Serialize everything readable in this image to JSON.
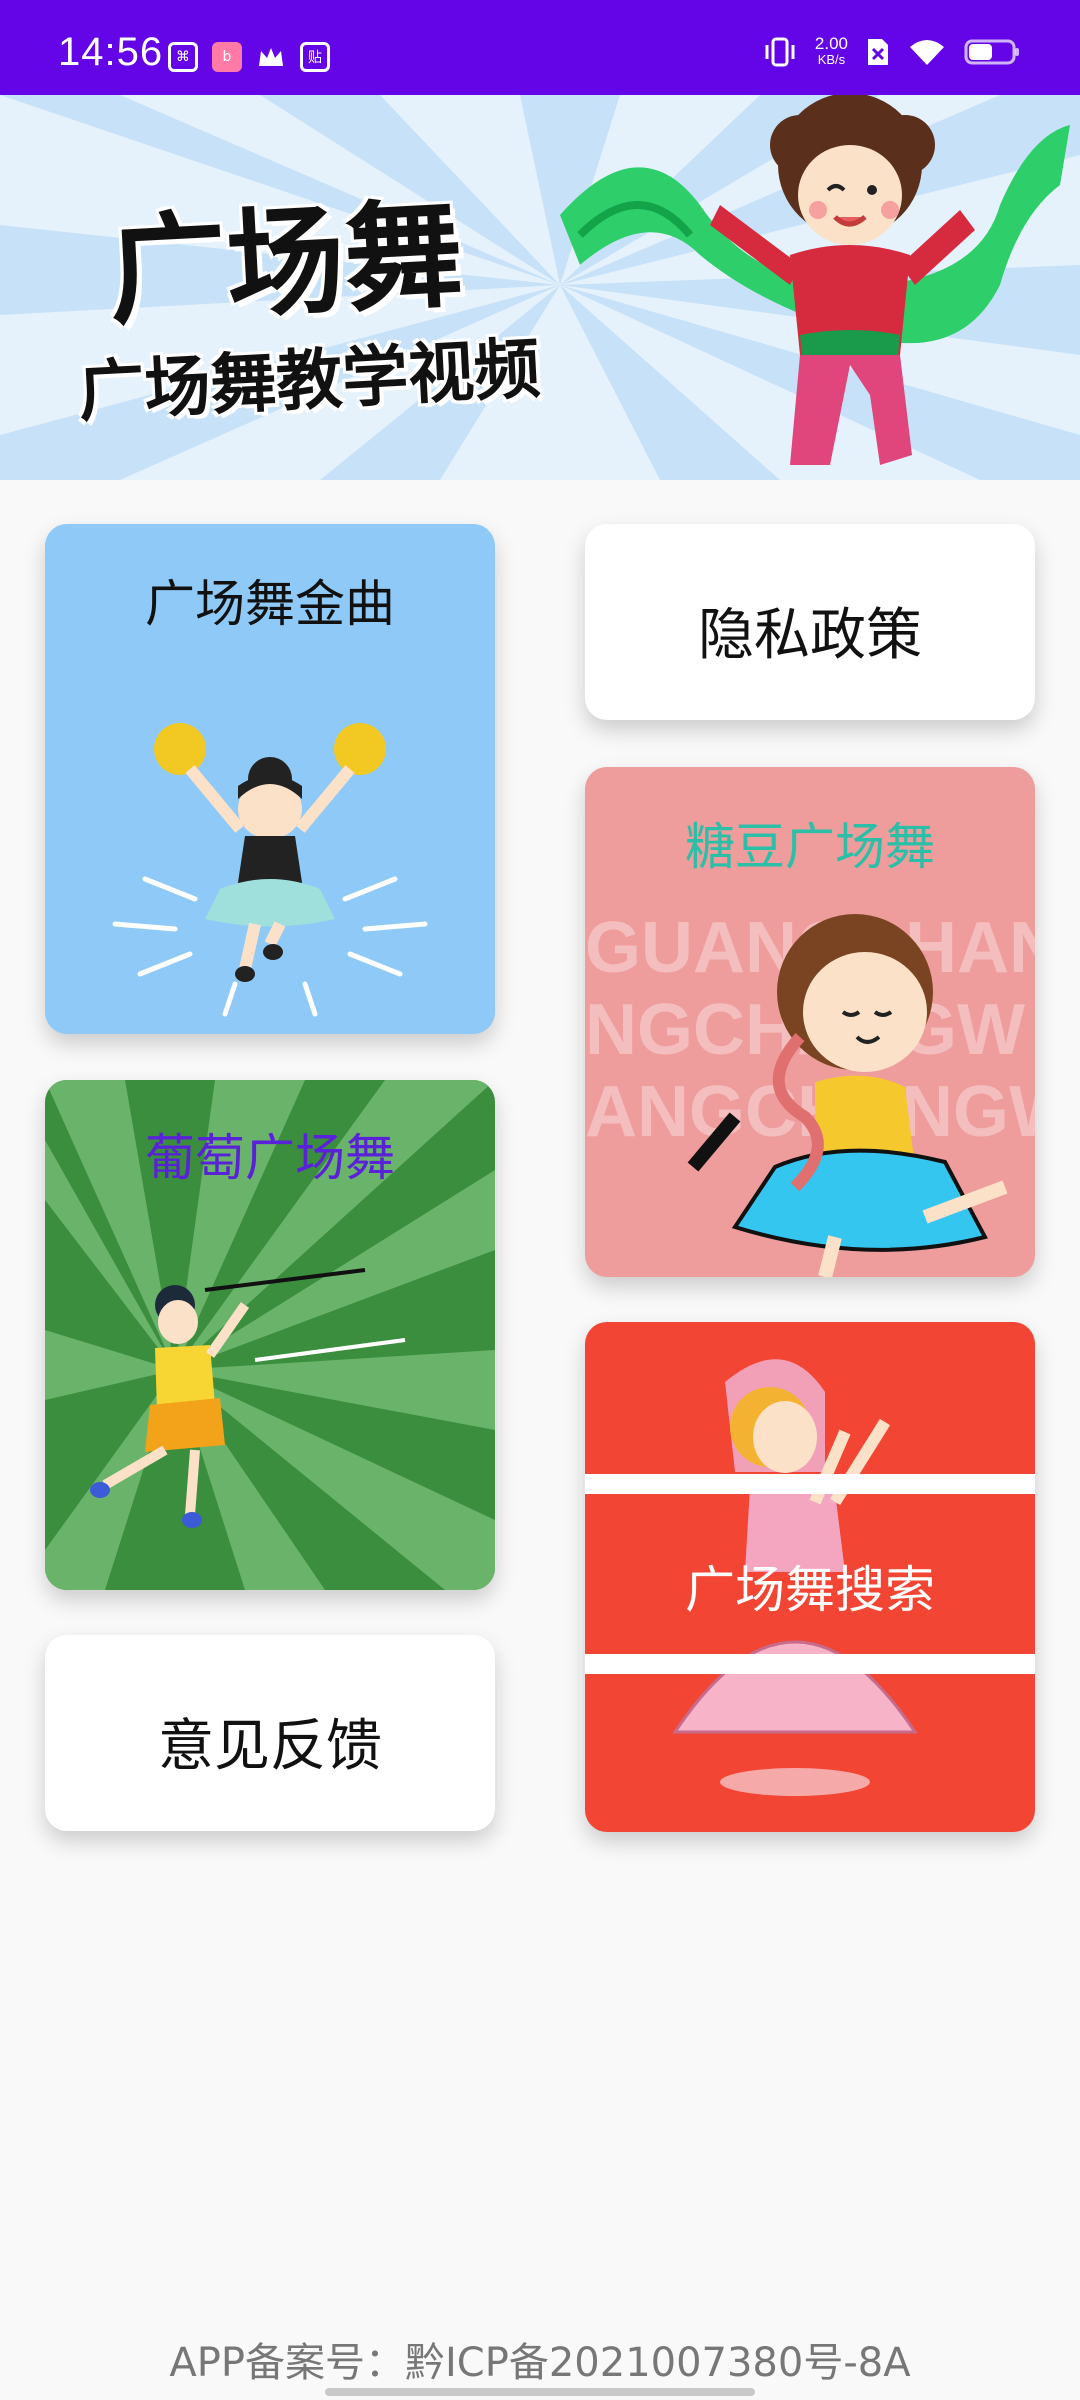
{
  "status_bar": {
    "time": "14:56",
    "left_icons": [
      "gallery-app-icon",
      "bilibili-icon",
      "crown-icon",
      "tieba-icon"
    ],
    "left_icon_glyphs": [
      "⌘",
      "b",
      "",
      "贴"
    ],
    "net_speed_value": "2.00",
    "net_speed_unit": "KB/s",
    "right_icons": [
      "vibrate-icon",
      "sim-x-icon",
      "wifi-icon",
      "battery-icon"
    ],
    "battery_level": 0.55,
    "background_color": "#6305e6"
  },
  "banner": {
    "title": "广场舞",
    "subtitle": "广场舞教学视频"
  },
  "cards": {
    "jinqu": {
      "label": "广场舞金曲",
      "bg": "#8ec9f7"
    },
    "privacy": {
      "label": "隐私政策",
      "bg": "#ffffff"
    },
    "tangdou": {
      "label": "糖豆广场舞",
      "bg": "#ee9c9c",
      "label_color": "#2bbfa8",
      "bg_text": [
        "GUANGCHAN",
        "NGCHANGW",
        "ANGCHANGW"
      ]
    },
    "putao": {
      "label": "葡萄广场舞",
      "bg": "#3b8e3e",
      "label_color": "#5a22d8"
    },
    "search": {
      "label": "广场舞搜索",
      "bg": "#f24533"
    },
    "feedback": {
      "label": "意见反馈",
      "bg": "#ffffff"
    }
  },
  "footer": {
    "text": "APP备案号：黔ICP备2021007380号-8A"
  }
}
